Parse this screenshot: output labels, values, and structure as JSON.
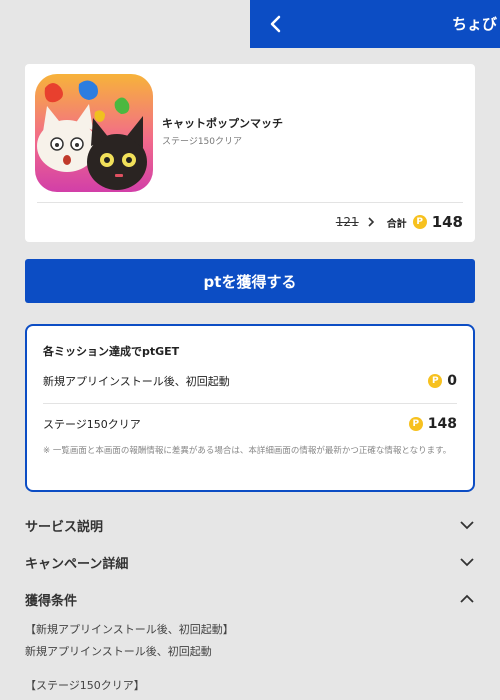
{
  "header": {
    "title": "ちょび"
  },
  "app": {
    "name": "キャットポップンマッチ",
    "subtitle": "ステージ150クリア",
    "old_points": "121",
    "total_label": "合計",
    "total_points": "148"
  },
  "coin_symbol": "P",
  "cta": {
    "label": "ptを獲得する"
  },
  "missions": {
    "title": "各ミッション達成でptGET",
    "items": [
      {
        "label": "新規アプリインストール後、初回起動",
        "points": "0"
      },
      {
        "label": "ステージ150クリア",
        "points": "148"
      }
    ],
    "note": "※ 一覧画面と本画面の報酬情報に差異がある場合は、本詳細画面の情報が最新かつ正確な情報となります。"
  },
  "sections": [
    {
      "label": "サービス説明",
      "expanded": false
    },
    {
      "label": "キャンペーン詳細",
      "expanded": false
    },
    {
      "label": "獲得条件",
      "expanded": true
    }
  ],
  "conditions": [
    {
      "heading": "【新規アプリインストール後、初回起動】",
      "text": "新規アプリインストール後、初回起動"
    },
    {
      "heading": "【ステージ150クリア】"
    }
  ],
  "colors": {
    "primary": "#0c4dc4",
    "coin": "#f7c11f",
    "background": "#e6e6e6"
  }
}
